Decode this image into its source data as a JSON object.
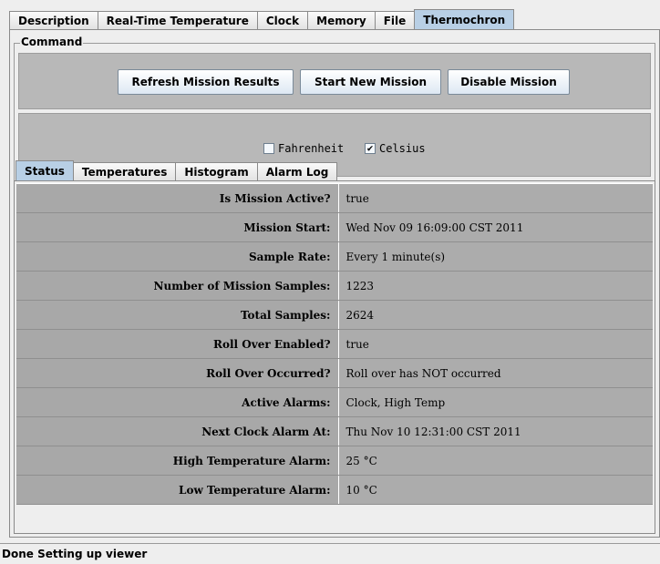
{
  "top_tabs": [
    "Description",
    "Real-Time Temperature",
    "Clock",
    "Memory",
    "File",
    "Thermochron"
  ],
  "command": {
    "title": "Command",
    "refresh_label": "Refresh Mission Results",
    "start_label": "Start New Mission",
    "disable_label": "Disable Mission",
    "fahrenheit_label": "Fahrenheit",
    "fahrenheit_checked": false,
    "celsius_label": "Celsius",
    "celsius_checked": true
  },
  "inner_tabs": [
    "Status",
    "Temperatures",
    "Histogram",
    "Alarm Log"
  ],
  "status_rows": [
    {
      "label": "Is Mission Active?",
      "value": "true"
    },
    {
      "label": "Mission Start:",
      "value": "Wed Nov 09 16:09:00 CST 2011"
    },
    {
      "label": "Sample Rate:",
      "value": "Every 1 minute(s)"
    },
    {
      "label": "Number of Mission Samples:",
      "value": "1223"
    },
    {
      "label": "Total Samples:",
      "value": "2624"
    },
    {
      "label": "Roll Over Enabled?",
      "value": "true"
    },
    {
      "label": "Roll Over Occurred?",
      "value": "Roll over has NOT occurred"
    },
    {
      "label": "Active Alarms:",
      "value": "Clock, High Temp"
    },
    {
      "label": "Next Clock Alarm At:",
      "value": "Thu Nov 10 12:31:00 CST 2011"
    },
    {
      "label": "High Temperature Alarm:",
      "value": "25 °C"
    },
    {
      "label": "Low Temperature Alarm:",
      "value": "10 °C"
    }
  ],
  "statusbar": {
    "text": "Done Setting up viewer"
  },
  "colors": {
    "active_tab": "#b8cfe5",
    "panel_gray": "#b8b8b8"
  }
}
